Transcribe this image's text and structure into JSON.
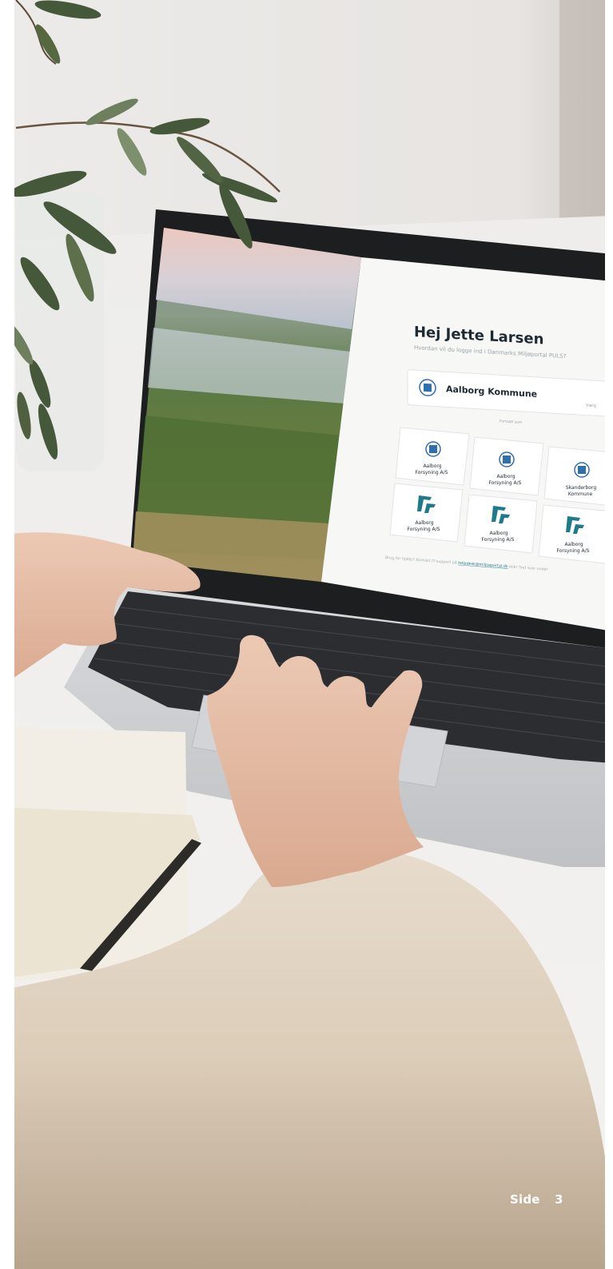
{
  "photo": {
    "description_free": true,
    "screen": {
      "greeting": "Hej Jette Larsen",
      "subtitle": "Hvordan vil du logge ind i Danmarks Miljøportal PULS?",
      "primary_org": "Aalborg Kommune",
      "primary_side": "Vælg",
      "divider_text": "Fortsæt som",
      "tiles": [
        {
          "line1": "Aalborg",
          "line2": "Forsyning A/S",
          "logo": "crest-icon"
        },
        {
          "line1": "Aalborg",
          "line2": "Forsyning A/S",
          "logo": "crest-icon"
        },
        {
          "line1": "Skanderborg",
          "line2": "Kommune",
          "logo": "crest-icon"
        },
        {
          "line1": "Aalborg",
          "line2": "Forsyning A/S",
          "logo": "forsyning-logo-icon"
        },
        {
          "line1": "Aalborg",
          "line2": "Forsyning A/S",
          "logo": "forsyning-logo-icon"
        },
        {
          "line1": "Aalborg",
          "line2": "Forsyning A/S",
          "logo": "forsyning-logo-icon"
        }
      ],
      "footer_before": "Brug for hjælp? Kontakt IT-support på",
      "footer_link": "helpdesk@miljoeportal.dk",
      "footer_after": "eller find svar under"
    }
  },
  "page_footer": {
    "label": "Side",
    "number": "3"
  },
  "colors": {
    "brand_teal": "#1f7a8c",
    "crest_blue": "#2e6fb0"
  }
}
